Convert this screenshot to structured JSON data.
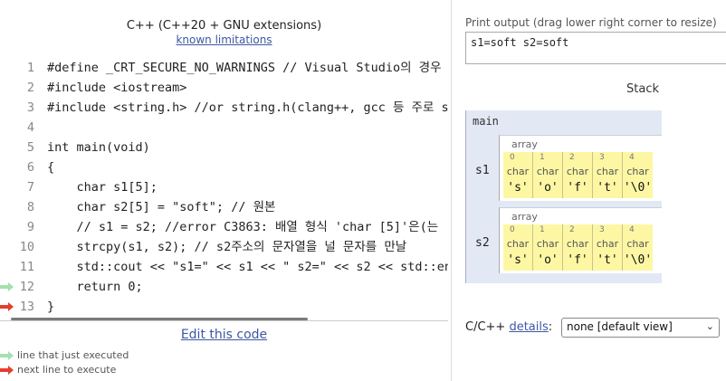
{
  "header": {
    "language": "C++ (C++20 + GNU extensions)",
    "limitations_link": "known limitations"
  },
  "code": {
    "lines": [
      {
        "num": "1",
        "text": "#define _CRT_SECURE_NO_WARNINGS // Visual Studio의 경우"
      },
      {
        "num": "2",
        "text": "#include <iostream>"
      },
      {
        "num": "3",
        "text": "#include <string.h> //or string.h(clang++, gcc 등 주로 s"
      },
      {
        "num": "4",
        "text": ""
      },
      {
        "num": "5",
        "text": "int main(void)"
      },
      {
        "num": "6",
        "text": "{"
      },
      {
        "num": "7",
        "text": "    char s1[5];"
      },
      {
        "num": "8",
        "text": "    char s2[5] = \"soft\"; // 원본"
      },
      {
        "num": "9",
        "text": "    // s1 = s2; //error C3863: 배열 형식 'char [5]'은(는"
      },
      {
        "num": "10",
        "text": "    strcpy(s1, s2); // s2주소의 문자열을 널 문자를 만날"
      },
      {
        "num": "11",
        "text": "    std::cout << \"s1=\" << s1 << \" s2=\" << s2 << std::end"
      },
      {
        "num": "12",
        "text": "    return 0;"
      },
      {
        "num": "13",
        "text": "}"
      }
    ],
    "just_executed_line": 12,
    "next_line": 13
  },
  "edit_link": "Edit this code",
  "legend": {
    "just_executed": "line that just executed",
    "next": "next line to execute"
  },
  "output": {
    "label": "Print output (drag lower right corner to resize)",
    "text": "s1=soft s2=soft"
  },
  "stack": {
    "header": "Stack",
    "frame": "main",
    "vars": [
      {
        "name": "s1",
        "kind": "array",
        "cells": [
          {
            "index": "0",
            "type": "char",
            "value": "'s'"
          },
          {
            "index": "1",
            "type": "char",
            "value": "'o'"
          },
          {
            "index": "2",
            "type": "char",
            "value": "'f'"
          },
          {
            "index": "3",
            "type": "char",
            "value": "'t'"
          },
          {
            "index": "4",
            "type": "char",
            "value": "'\\0'"
          }
        ]
      },
      {
        "name": "s2",
        "kind": "array",
        "cells": [
          {
            "index": "0",
            "type": "char",
            "value": "'s'"
          },
          {
            "index": "1",
            "type": "char",
            "value": "'o'"
          },
          {
            "index": "2",
            "type": "char",
            "value": "'f'"
          },
          {
            "index": "3",
            "type": "char",
            "value": "'t'"
          },
          {
            "index": "4",
            "type": "char",
            "value": "'\\0'"
          }
        ]
      }
    ]
  },
  "details": {
    "prefix": "C/C++ ",
    "link": "details",
    "suffix": ":",
    "selected": "none [default view]"
  },
  "colors": {
    "link": "#3D58A2",
    "just_executed_arrow": "#a4e0b0",
    "next_arrow": "#e53e2e",
    "frame_bg": "#e2e9f4",
    "cell_bg": "#fdf7a4"
  }
}
